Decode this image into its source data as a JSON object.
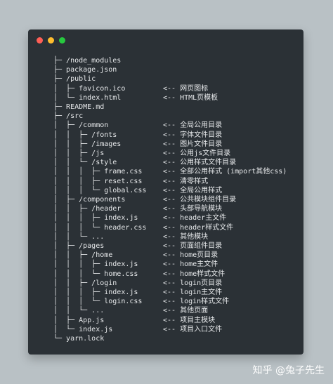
{
  "colors": {
    "background": "#b9c1c5",
    "window_bg": "#2b3136",
    "text": "#e6e8ea",
    "dot_red": "#ff5f56",
    "dot_yellow": "#ffbd2e",
    "dot_green": "#27c93f"
  },
  "tree": [
    {
      "tree": "├─ /node_modules",
      "comment": ""
    },
    {
      "tree": "├─ package.json",
      "comment": ""
    },
    {
      "tree": "├─ /public",
      "comment": ""
    },
    {
      "tree": "│  ├─ favicon.ico",
      "comment": "<-- 网页图标"
    },
    {
      "tree": "│  └─ index.html",
      "comment": "<-- HTML页模板"
    },
    {
      "tree": "├─ README.md",
      "comment": ""
    },
    {
      "tree": "├─ /src",
      "comment": ""
    },
    {
      "tree": "│  ├─ /common",
      "comment": "<-- 全局公用目录"
    },
    {
      "tree": "│  │  ├─ /fonts",
      "comment": "<-- 字体文件目录"
    },
    {
      "tree": "│  │  ├─ /images",
      "comment": "<-- 图片文件目录"
    },
    {
      "tree": "│  │  ├─ /js",
      "comment": "<-- 公用js文件目录"
    },
    {
      "tree": "│  │  └─ /style",
      "comment": "<-- 公用样式文件目录"
    },
    {
      "tree": "│  │  │  ├─ frame.css",
      "comment": "<-- 全部公用样式 (import其他css)"
    },
    {
      "tree": "│  │  │  ├─ reset.css",
      "comment": "<-- 清零样式"
    },
    {
      "tree": "│  │  │  └─ global.css",
      "comment": "<-- 全局公用样式"
    },
    {
      "tree": "│  ├─ /components",
      "comment": "<-- 公共模块组件目录"
    },
    {
      "tree": "│  │  ├─ /header",
      "comment": "<-- 头部导航模块"
    },
    {
      "tree": "│  │  │  ├─ index.js",
      "comment": "<-- header主文件"
    },
    {
      "tree": "│  │  │  └─ header.css",
      "comment": "<-- header样式文件"
    },
    {
      "tree": "│  │  └─ ...",
      "comment": "<-- 其他模块"
    },
    {
      "tree": "│  ├─ /pages",
      "comment": "<-- 页面组件目录"
    },
    {
      "tree": "│  │  ├─ /home",
      "comment": "<-- home页目录"
    },
    {
      "tree": "│  │  │  ├─ index.js",
      "comment": "<-- home主文件"
    },
    {
      "tree": "│  │  │  └─ home.css",
      "comment": "<-- home样式文件"
    },
    {
      "tree": "│  │  ├─ /login",
      "comment": "<-- login页目录"
    },
    {
      "tree": "│  │  │  ├─ index.js",
      "comment": "<-- login主文件"
    },
    {
      "tree": "│  │  │  └─ login.css",
      "comment": "<-- login样式文件"
    },
    {
      "tree": "│  │  └─ ...",
      "comment": "<-- 其他页面"
    },
    {
      "tree": "│  ├─ App.js",
      "comment": "<-- 项目主模块"
    },
    {
      "tree": "│  └─ index.js",
      "comment": "<-- 项目入口文件"
    },
    {
      "tree": "└─ yarn.lock",
      "comment": ""
    }
  ],
  "watermark": "知乎 @兔子先生"
}
